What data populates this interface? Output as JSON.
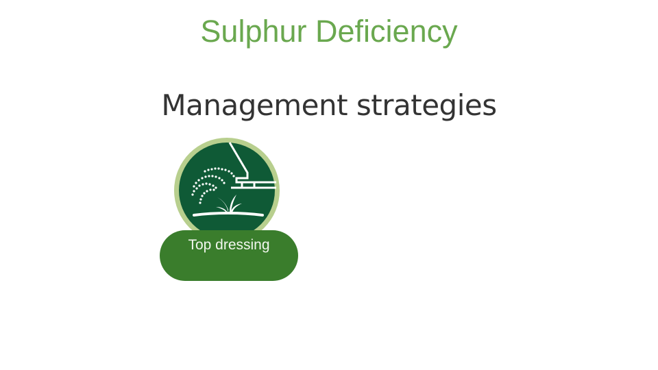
{
  "page": {
    "title": "Sulphur Deficiency",
    "section_heading": "Management strategies"
  },
  "strategies": [
    {
      "label": "Top dressing",
      "icon": "top-dressing-icon"
    }
  ],
  "colors": {
    "title": "#6aa84f",
    "heading": "#333333",
    "icon_fill": "#0f5a36",
    "icon_ring": "#b8cf8e",
    "label_bg": "#3a7d2c"
  }
}
